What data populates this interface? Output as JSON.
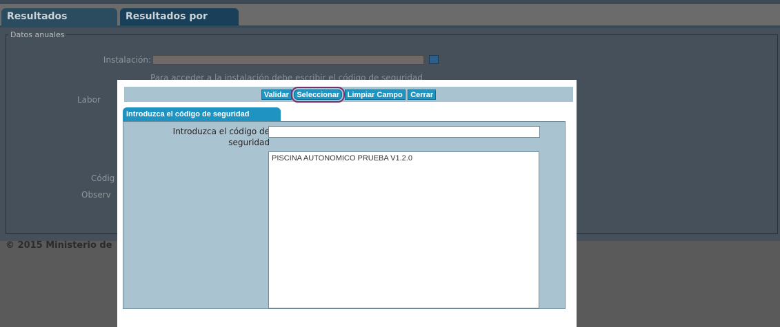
{
  "background": {
    "tabs": [
      "Resultados anuales",
      "Resultados por vaso"
    ],
    "legend": "Datos anuales",
    "installation_label": "Instalación:",
    "installation_note": "Para acceder a la instalación debe escribir el código de seguridad",
    "partial_labels": [
      "Labor",
      "Códig",
      "Observ"
    ],
    "copyright": "© 2015 Ministerio de"
  },
  "modal": {
    "toolbar": {
      "buttons": [
        "Validar",
        "Seleccionar",
        "Limpiar Campo",
        "Cerrar"
      ]
    },
    "tab_label": "Introduzca el código de seguridad",
    "code_label": "Introduzca el código de seguridad",
    "code_value": "",
    "list_items": [
      "PISCINA AUTONOMICO PRUEBA V1.2.0"
    ]
  },
  "colors": {
    "accent": "#1f95c4",
    "panel": "#a9c3d1",
    "highlight_outline": "#7a2e6a"
  }
}
